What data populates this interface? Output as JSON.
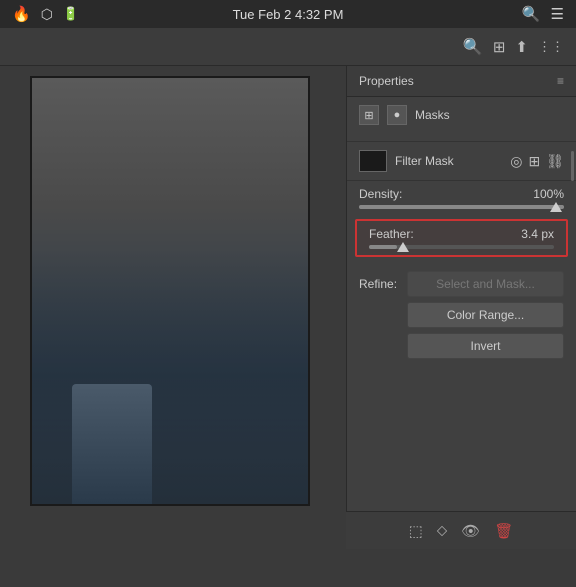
{
  "menubar": {
    "time": "Tue Feb 2  4:32 PM",
    "icons_left": [
      "flame-icon",
      "shield-icon"
    ],
    "icons_right": [
      "search-icon",
      "list-icon"
    ]
  },
  "app_toolbar": {
    "icons": [
      "zoom-icon",
      "layout-icon",
      "share-icon",
      "more-icon"
    ]
  },
  "properties_panel": {
    "title": "Properties",
    "menu_icon": "≡",
    "masks": {
      "icon1": "⊞",
      "icon2": "●",
      "label": "Masks"
    },
    "filter_mask": {
      "label": "Filter Mask",
      "icons": [
        "circle-icon",
        "grid-icon",
        "link-icon"
      ]
    },
    "density": {
      "label": "Density:",
      "value": "100%",
      "fill_percent": 100
    },
    "feather": {
      "label": "Feather:",
      "value": "3.4 px",
      "fill_percent": 15,
      "highlighted": true
    },
    "refine": {
      "label": "Refine:",
      "select_mask_button": "Select and Mask...",
      "color_range_button": "Color Range...",
      "invert_button": "Invert"
    }
  },
  "bottom_toolbar": {
    "icons": [
      "selection-icon",
      "refine-icon",
      "visibility-icon",
      "trash-icon"
    ]
  }
}
